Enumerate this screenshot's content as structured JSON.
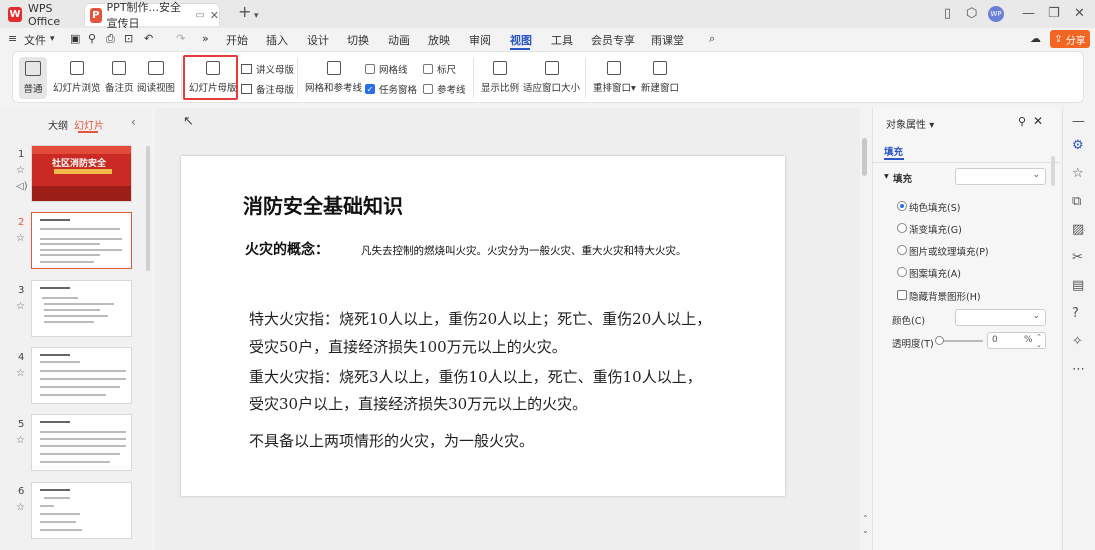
{
  "titlebar": {
    "app_tab": "WPS Office",
    "doc_tab": "PPT制作...安全宣传日",
    "avatar": "WP"
  },
  "menu": {
    "file": "文件",
    "items": [
      "开始",
      "插入",
      "设计",
      "切换",
      "动画",
      "放映",
      "审阅",
      "视图",
      "工具",
      "会员专享",
      "雨课堂"
    ],
    "active": "视图",
    "share": "分享"
  },
  "ribbon": {
    "normal": "普通",
    "slide_sorter": "幻灯片浏览",
    "notes_page": "备注页",
    "reading_view": "阅读视图",
    "slide_master": "幻灯片母版",
    "handout_master": "讲义母版",
    "notes_master": "备注母版",
    "grid_guides": "网格和参考线",
    "gridlines": "网格线",
    "ruler": "标尺",
    "task_pane": "任务窗格",
    "guides": "参考线",
    "zoom": "显示比例",
    "fit_window": "适应窗口大小",
    "arrange": "重排窗口",
    "new_window": "新建窗口"
  },
  "leftpanel": {
    "tab_outline": "大纲",
    "tab_slides": "幻灯片",
    "slide_numbers": [
      "1",
      "2",
      "3",
      "4",
      "5",
      "6"
    ],
    "slide1_title": "社区消防安全"
  },
  "slide": {
    "title": "消防安全基础知识",
    "label": "火灾的概念：",
    "definition": "凡失去控制的燃烧叫火灾。火灾分为一般火灾、重大火灾和特大火灾。",
    "para1_line1": "特大火灾指：烧死10人以上，重伤20人以上；死亡、重伤20人以上，",
    "para1_line2": "受灾50户，直接经济损失100万元以上的火灾。",
    "para2_line1": "重大火灾指：烧死3人以上，重伤10人以上，死亡、重伤10人以上，",
    "para2_line2": "受灾30户以上，直接经济损失30万元以上的火灾。",
    "para3": "不具备以上两项情形的火灾，为一般火灾。"
  },
  "rightpanel": {
    "title": "对象属性",
    "tab_fill": "填充",
    "section_fill": "填充",
    "options": [
      "纯色填充(S)",
      "渐变填充(G)",
      "图片或纹理填充(P)",
      "图案填充(A)"
    ],
    "hide_bg": "隐藏背景图形(H)",
    "color_label": "颜色(C)",
    "transparency_label": "透明度(T)",
    "transparency_value": "0",
    "transparency_unit": "%"
  },
  "colors": {
    "accent": "#2a55c5",
    "share": "#f26522",
    "highlight": "#e63b3b",
    "selected_slide": "#e2573c"
  }
}
